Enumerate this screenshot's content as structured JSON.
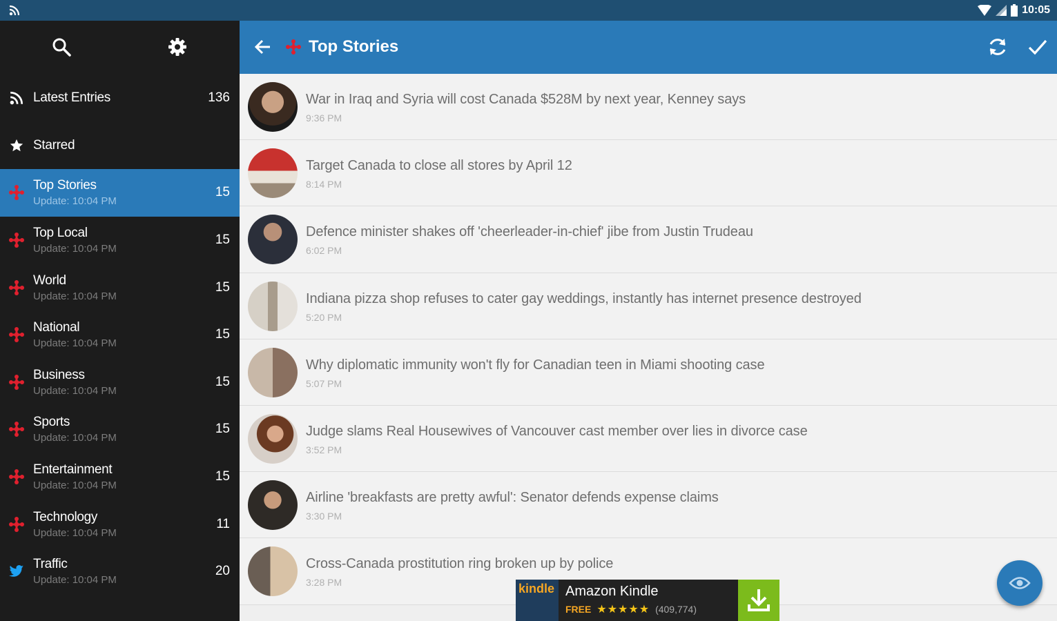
{
  "status_bar": {
    "time": "10:05",
    "icons": [
      "rss-icon",
      "wifi-icon",
      "cell-signal-icon",
      "battery-icon"
    ]
  },
  "sidebar": {
    "top_icons": [
      "search-icon",
      "settings-icon"
    ],
    "items": [
      {
        "label": "Latest Entries",
        "sub": "",
        "count": "136",
        "icon": "rss-icon"
      },
      {
        "label": "Starred",
        "sub": "",
        "count": "",
        "icon": "star-icon"
      },
      {
        "label": "Top Stories",
        "sub": "Update: 10:04 PM",
        "count": "15",
        "icon": "cbc-icon",
        "active": true
      },
      {
        "label": "Top Local",
        "sub": "Update: 10:04 PM",
        "count": "15",
        "icon": "cbc-icon"
      },
      {
        "label": "World",
        "sub": "Update: 10:04 PM",
        "count": "15",
        "icon": "cbc-icon"
      },
      {
        "label": "National",
        "sub": "Update: 10:04 PM",
        "count": "15",
        "icon": "cbc-icon"
      },
      {
        "label": "Business",
        "sub": "Update: 10:04 PM",
        "count": "15",
        "icon": "cbc-icon"
      },
      {
        "label": "Sports",
        "sub": "Update: 10:04 PM",
        "count": "15",
        "icon": "cbc-icon"
      },
      {
        "label": "Entertainment",
        "sub": "Update: 10:04 PM",
        "count": "15",
        "icon": "cbc-icon"
      },
      {
        "label": "Technology",
        "sub": "Update: 10:04 PM",
        "count": "11",
        "icon": "cbc-icon"
      },
      {
        "label": "Traffic",
        "sub": "Update: 10:04 PM",
        "count": "20",
        "icon": "twitter-icon"
      }
    ]
  },
  "toolbar": {
    "title": "Top Stories",
    "icons": [
      "back-arrow-icon",
      "cbc-icon",
      "refresh-icon",
      "check-icon"
    ]
  },
  "articles": [
    {
      "headline": "War in Iraq and Syria will cost Canada $528M by next year, Kenney says",
      "time": "9:36 PM"
    },
    {
      "headline": "Target Canada to close all stores by April 12",
      "time": "8:14 PM"
    },
    {
      "headline": "Defence minister shakes off 'cheerleader-in-chief' jibe from Justin Trudeau",
      "time": "6:02 PM"
    },
    {
      "headline": "Indiana pizza shop refuses to cater gay weddings, instantly has internet presence destroyed",
      "time": "5:20 PM"
    },
    {
      "headline": "Why diplomatic immunity won't fly for Canadian teen in Miami shooting case",
      "time": "5:07 PM"
    },
    {
      "headline": "Judge slams Real Housewives of Vancouver cast member over lies in divorce case",
      "time": "3:52 PM"
    },
    {
      "headline": "Airline 'breakfasts are pretty awful': Senator defends expense claims",
      "time": "3:30 PM"
    },
    {
      "headline": "Cross-Canada prostitution ring broken up by police",
      "time": "3:28 PM"
    }
  ],
  "ad": {
    "logo": "kindle",
    "name": "Amazon Kindle",
    "price": "FREE",
    "stars": "★★★★★",
    "reviews": "(409,774)"
  },
  "colors": {
    "status_bar": "#1f4f72",
    "accent": "#2a7ab8",
    "sidebar_bg": "#1c1c1c",
    "list_bg": "#f2f2f2",
    "cbc_red": "#e0202e"
  },
  "fab_icon": "eye-icon"
}
